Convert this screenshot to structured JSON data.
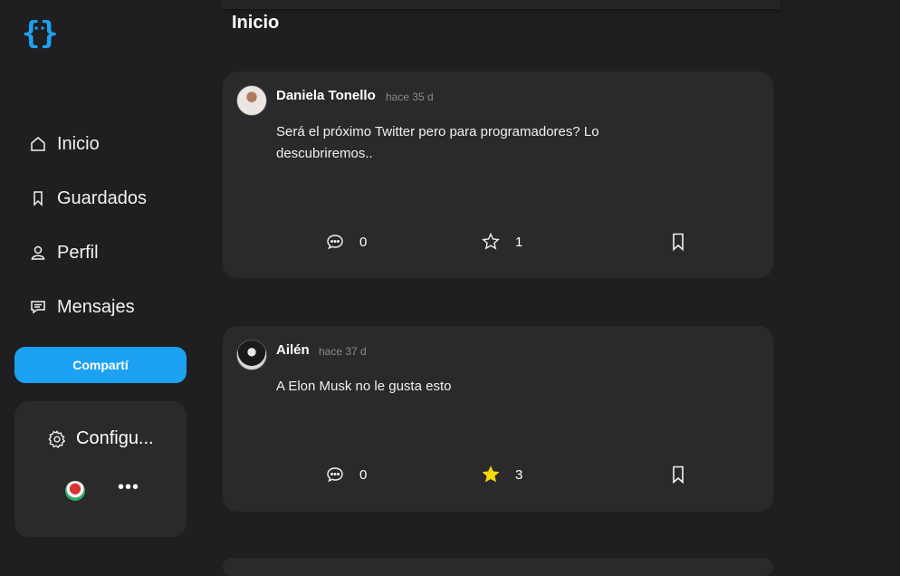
{
  "sidebar": {
    "logo_icon": "curly-braces-logo-icon",
    "nav": [
      {
        "label": "Inicio",
        "icon": "home-icon"
      },
      {
        "label": "Guardados",
        "icon": "bookmark-icon"
      },
      {
        "label": "Perfil",
        "icon": "user-icon"
      },
      {
        "label": "Mensajes",
        "icon": "message-icon"
      }
    ],
    "share_label": "Compartí",
    "config_label": "Configu...",
    "more_label": "•••"
  },
  "header": {
    "title": "Inicio"
  },
  "posts": [
    {
      "author": "Daniela Tonello",
      "time": "hace 35 d",
      "content": "Será el próximo Twitter pero para programadores? Lo descubriremos..",
      "comments": "0",
      "stars": "1",
      "starred": false
    },
    {
      "author": "Ailén",
      "time": "hace 37 d",
      "content": "A Elon Musk no le gusta esto",
      "comments": "0",
      "stars": "3",
      "starred": true
    }
  ],
  "colors": {
    "background": "#1f1f21",
    "card": "#2a2a2c",
    "accent": "#1da1f2",
    "star_active": "#f5d90a"
  }
}
